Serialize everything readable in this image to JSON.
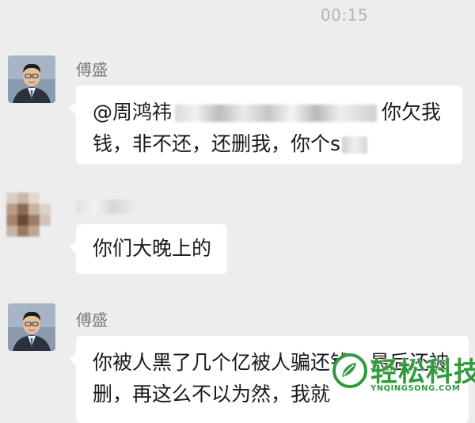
{
  "header": {
    "timestamp": "00:15"
  },
  "messages": [
    {
      "sender": "傅盛",
      "text_before_blur": "@周鸿祎",
      "text_mid": "你欠我",
      "text_line2": "钱，非不还，还删我，你个s"
    },
    {
      "sender_blurred": "",
      "text": "你们大晚上的"
    },
    {
      "sender": "傅盛",
      "text_line1": "你被人黑了几个亿被人骗还钱，最后还被",
      "text_line2": "删，再这么不以为然，我就"
    }
  ],
  "watermark": {
    "text": "轻松科技",
    "domain": "YNQINGSONG.COM",
    "color": "#2f9b3b"
  }
}
